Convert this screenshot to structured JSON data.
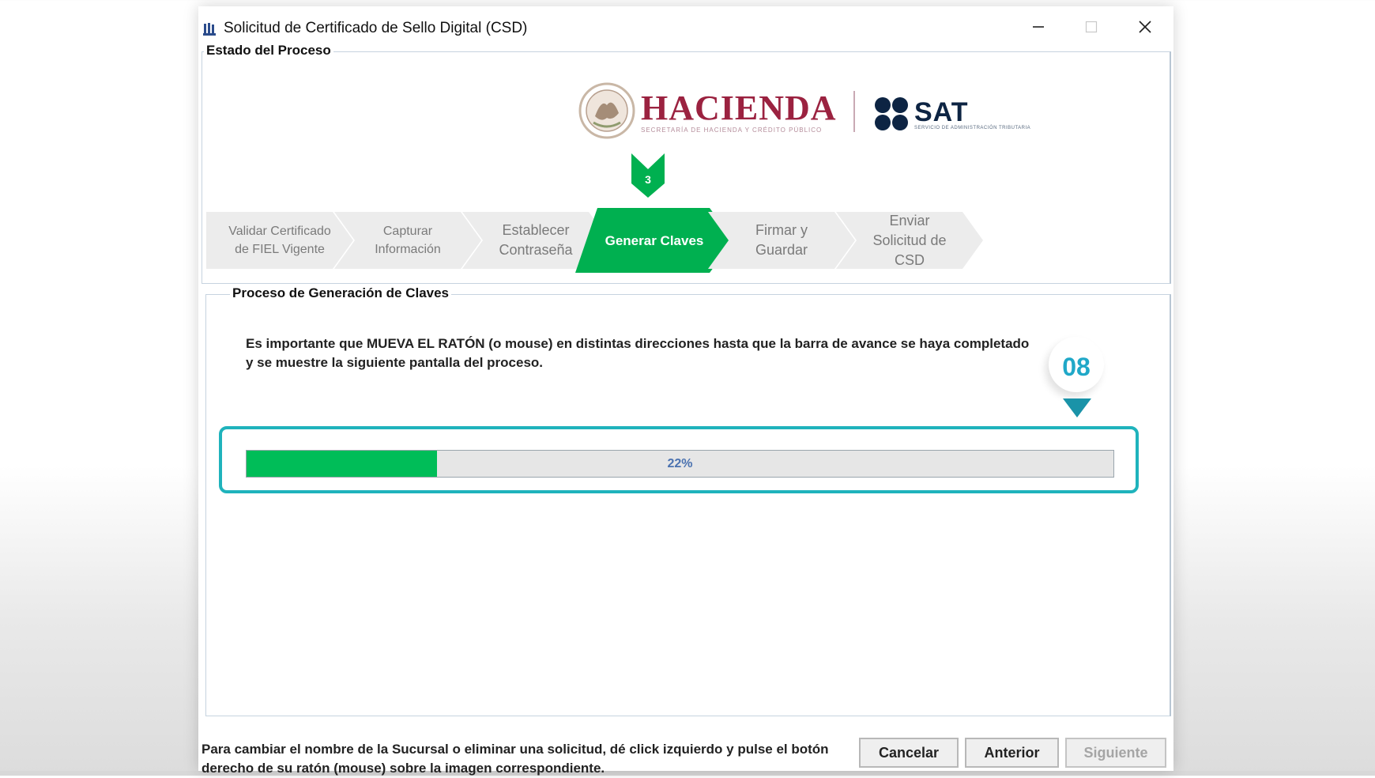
{
  "window": {
    "title": "Solicitud de Certificado de Sello Digital (CSD)"
  },
  "estado": {
    "label": "Estado del Proceso",
    "logos": {
      "hacienda": "HACIENDA",
      "hacienda_sub": "SECRETARÍA DE HACIENDA Y CRÉDITO PÚBLICO",
      "sat": "SAT",
      "sat_sub": "SERVICIO DE ADMINISTRACIÓN TRIBUTARIA"
    },
    "current_step_number": "3",
    "steps": [
      {
        "label": "Validar Certificado de FIEL Vigente",
        "active": false
      },
      {
        "label": "Capturar Información",
        "active": false
      },
      {
        "label": "Establecer Contraseña",
        "active": false
      },
      {
        "label": "Generar Claves",
        "active": true
      },
      {
        "label": "Firmar y Guardar",
        "active": false
      },
      {
        "label": "Enviar Solicitud de CSD",
        "active": false
      }
    ]
  },
  "proceso": {
    "label": "Proceso de Generación de Claves",
    "instruction": "Es importante que MUEVA EL RATÓN (o mouse) en distintas direcciones hasta que la barra de avance se haya completado y se muestre la siguiente pantalla del proceso.",
    "progress": {
      "value": 0.22,
      "text": "22%"
    },
    "callout": "08"
  },
  "footer": {
    "note": "Para cambiar el nombre de la Sucursal o eliminar una solicitud, dé click izquierdo y pulse el botón derecho de su ratón (mouse) sobre la imagen correspondiente.",
    "buttons": {
      "cancel": "Cancelar",
      "previous": "Anterior",
      "next": "Siguiente"
    }
  },
  "colors": {
    "active_step": "#00b050",
    "progress_fill": "#00bd58",
    "highlight": "#1fb3bc",
    "hacienda": "#9b2240",
    "sat": "#0d2443"
  },
  "icons": [
    "app-icon",
    "minimize-icon",
    "maximize-icon",
    "close-icon",
    "step-marker-icon",
    "callout-pointer-icon"
  ]
}
